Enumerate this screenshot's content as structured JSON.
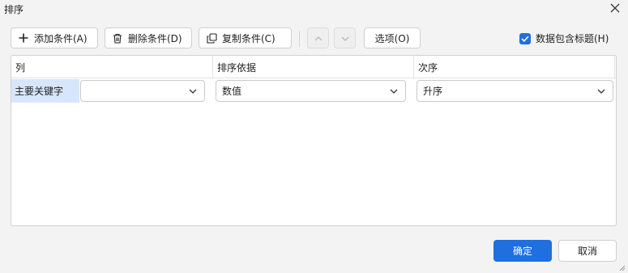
{
  "window": {
    "title": "排序",
    "close_icon": "close-icon"
  },
  "toolbar": {
    "add_label": "添加条件(A)",
    "add_icon": "plus-icon",
    "delete_label": "删除条件(D)",
    "delete_icon": "trash-icon",
    "copy_label": "复制条件(C)",
    "copy_icon": "copy-icon",
    "move_up_icon": "chevron-up-icon",
    "move_down_icon": "chevron-down-icon",
    "options_label": "选项(O)",
    "header_checkbox_label": "数据包含标题(H)",
    "header_checkbox_checked": true
  },
  "grid": {
    "columns": [
      "列",
      "排序依据",
      "次序"
    ],
    "rows": [
      {
        "label": "主要关键字",
        "column_value": "",
        "sort_on_value": "数值",
        "order_value": "升序"
      }
    ]
  },
  "footer": {
    "ok_label": "确定",
    "cancel_label": "取消"
  },
  "colors": {
    "accent": "#1f6fde",
    "row_highlight": "#d7e6fb",
    "background": "#f3f3f3"
  }
}
